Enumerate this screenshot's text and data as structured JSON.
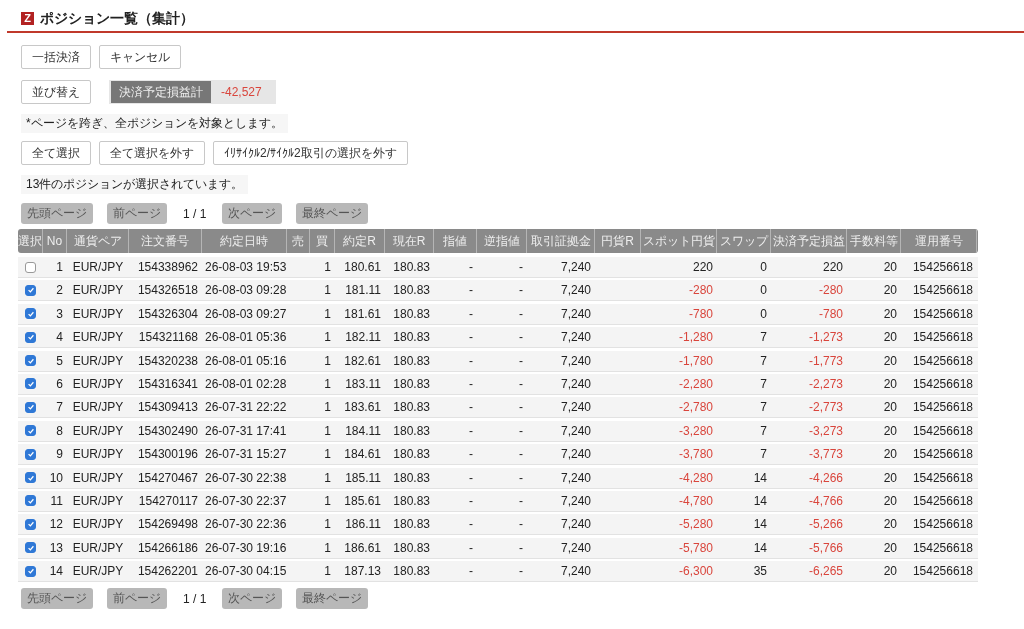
{
  "header": {
    "logo_letter": "Z",
    "title": "ポジション一覧（集計）"
  },
  "action_buttons": [
    "一括決済",
    "キャンセル"
  ],
  "sort_button": "並び替え",
  "total": {
    "label": "決済予定損益計",
    "value": "-42,527"
  },
  "note": "*ページを跨ぎ、全ポジションを対象とします。",
  "select_buttons": [
    "全て選択",
    "全て選択を外す",
    "ｲﾘｻｲｸﾙ2/ｻｲｸﾙ2取引の選択を外す"
  ],
  "selected_count": "13件のポジションが選択されています。",
  "pager_top": {
    "first": "先頭ページ",
    "prev": "前ページ",
    "page": "1 / 1",
    "next": "次ページ",
    "last": "最終ページ"
  },
  "table": {
    "columns": [
      "選択",
      "No",
      "通貨ペア",
      "注文番号",
      "約定日時",
      "売",
      "買",
      "約定R",
      "現在R",
      "指値",
      "逆指値",
      "取引証拠金",
      "円貨R",
      "スポット円貨",
      "スワップ",
      "決済予定損益",
      "手数料等",
      "運用番号"
    ],
    "rows": [
      {
        "selected": false,
        "loss": false,
        "cells": [
          "",
          "1",
          "EUR/JPY",
          "154338962",
          "26-08-03 19:53",
          "",
          "1",
          "180.61",
          "180.83",
          "-",
          "-",
          "7,240",
          "",
          "220",
          "0",
          "220",
          "20",
          "154256618"
        ]
      },
      {
        "selected": true,
        "loss": true,
        "cells": [
          "",
          "2",
          "EUR/JPY",
          "154326518",
          "26-08-03 09:28",
          "",
          "1",
          "181.11",
          "180.83",
          "-",
          "-",
          "7,240",
          "",
          "-280",
          "0",
          "-280",
          "20",
          "154256618"
        ]
      },
      {
        "selected": true,
        "loss": true,
        "cells": [
          "",
          "3",
          "EUR/JPY",
          "154326304",
          "26-08-03 09:27",
          "",
          "1",
          "181.61",
          "180.83",
          "-",
          "-",
          "7,240",
          "",
          "-780",
          "0",
          "-780",
          "20",
          "154256618"
        ]
      },
      {
        "selected": true,
        "loss": true,
        "cells": [
          "",
          "4",
          "EUR/JPY",
          "154321168",
          "26-08-01 05:36",
          "",
          "1",
          "182.11",
          "180.83",
          "-",
          "-",
          "7,240",
          "",
          "-1,280",
          "7",
          "-1,273",
          "20",
          "154256618"
        ]
      },
      {
        "selected": true,
        "loss": true,
        "cells": [
          "",
          "5",
          "EUR/JPY",
          "154320238",
          "26-08-01 05:16",
          "",
          "1",
          "182.61",
          "180.83",
          "-",
          "-",
          "7,240",
          "",
          "-1,780",
          "7",
          "-1,773",
          "20",
          "154256618"
        ]
      },
      {
        "selected": true,
        "loss": true,
        "cells": [
          "",
          "6",
          "EUR/JPY",
          "154316341",
          "26-08-01 02:28",
          "",
          "1",
          "183.11",
          "180.83",
          "-",
          "-",
          "7,240",
          "",
          "-2,280",
          "7",
          "-2,273",
          "20",
          "154256618"
        ]
      },
      {
        "selected": true,
        "loss": true,
        "cells": [
          "",
          "7",
          "EUR/JPY",
          "154309413",
          "26-07-31 22:22",
          "",
          "1",
          "183.61",
          "180.83",
          "-",
          "-",
          "7,240",
          "",
          "-2,780",
          "7",
          "-2,773",
          "20",
          "154256618"
        ]
      },
      {
        "selected": true,
        "loss": true,
        "cells": [
          "",
          "8",
          "EUR/JPY",
          "154302490",
          "26-07-31 17:41",
          "",
          "1",
          "184.11",
          "180.83",
          "-",
          "-",
          "7,240",
          "",
          "-3,280",
          "7",
          "-3,273",
          "20",
          "154256618"
        ]
      },
      {
        "selected": true,
        "loss": true,
        "cells": [
          "",
          "9",
          "EUR/JPY",
          "154300196",
          "26-07-31 15:27",
          "",
          "1",
          "184.61",
          "180.83",
          "-",
          "-",
          "7,240",
          "",
          "-3,780",
          "7",
          "-3,773",
          "20",
          "154256618"
        ]
      },
      {
        "selected": true,
        "loss": true,
        "cells": [
          "",
          "10",
          "EUR/JPY",
          "154270467",
          "26-07-30 22:38",
          "",
          "1",
          "185.11",
          "180.83",
          "-",
          "-",
          "7,240",
          "",
          "-4,280",
          "14",
          "-4,266",
          "20",
          "154256618"
        ]
      },
      {
        "selected": true,
        "loss": true,
        "cells": [
          "",
          "11",
          "EUR/JPY",
          "154270117",
          "26-07-30 22:37",
          "",
          "1",
          "185.61",
          "180.83",
          "-",
          "-",
          "7,240",
          "",
          "-4,780",
          "14",
          "-4,766",
          "20",
          "154256618"
        ]
      },
      {
        "selected": true,
        "loss": true,
        "cells": [
          "",
          "12",
          "EUR/JPY",
          "154269498",
          "26-07-30 22:36",
          "",
          "1",
          "186.11",
          "180.83",
          "-",
          "-",
          "7,240",
          "",
          "-5,280",
          "14",
          "-5,266",
          "20",
          "154256618"
        ]
      },
      {
        "selected": true,
        "loss": true,
        "cells": [
          "",
          "13",
          "EUR/JPY",
          "154266186",
          "26-07-30 19:16",
          "",
          "1",
          "186.61",
          "180.83",
          "-",
          "-",
          "7,240",
          "",
          "-5,780",
          "14",
          "-5,766",
          "20",
          "154256618"
        ]
      },
      {
        "selected": true,
        "loss": true,
        "cells": [
          "",
          "14",
          "EUR/JPY",
          "154262201",
          "26-07-30 04:15",
          "",
          "1",
          "187.13",
          "180.83",
          "-",
          "-",
          "7,240",
          "",
          "-6,300",
          "35",
          "-6,265",
          "20",
          "154256618"
        ]
      }
    ]
  },
  "pager_bottom": {
    "first": "先頭ページ",
    "prev": "前ページ",
    "page": "1 / 1",
    "next": "次ページ",
    "last": "最終ページ"
  }
}
